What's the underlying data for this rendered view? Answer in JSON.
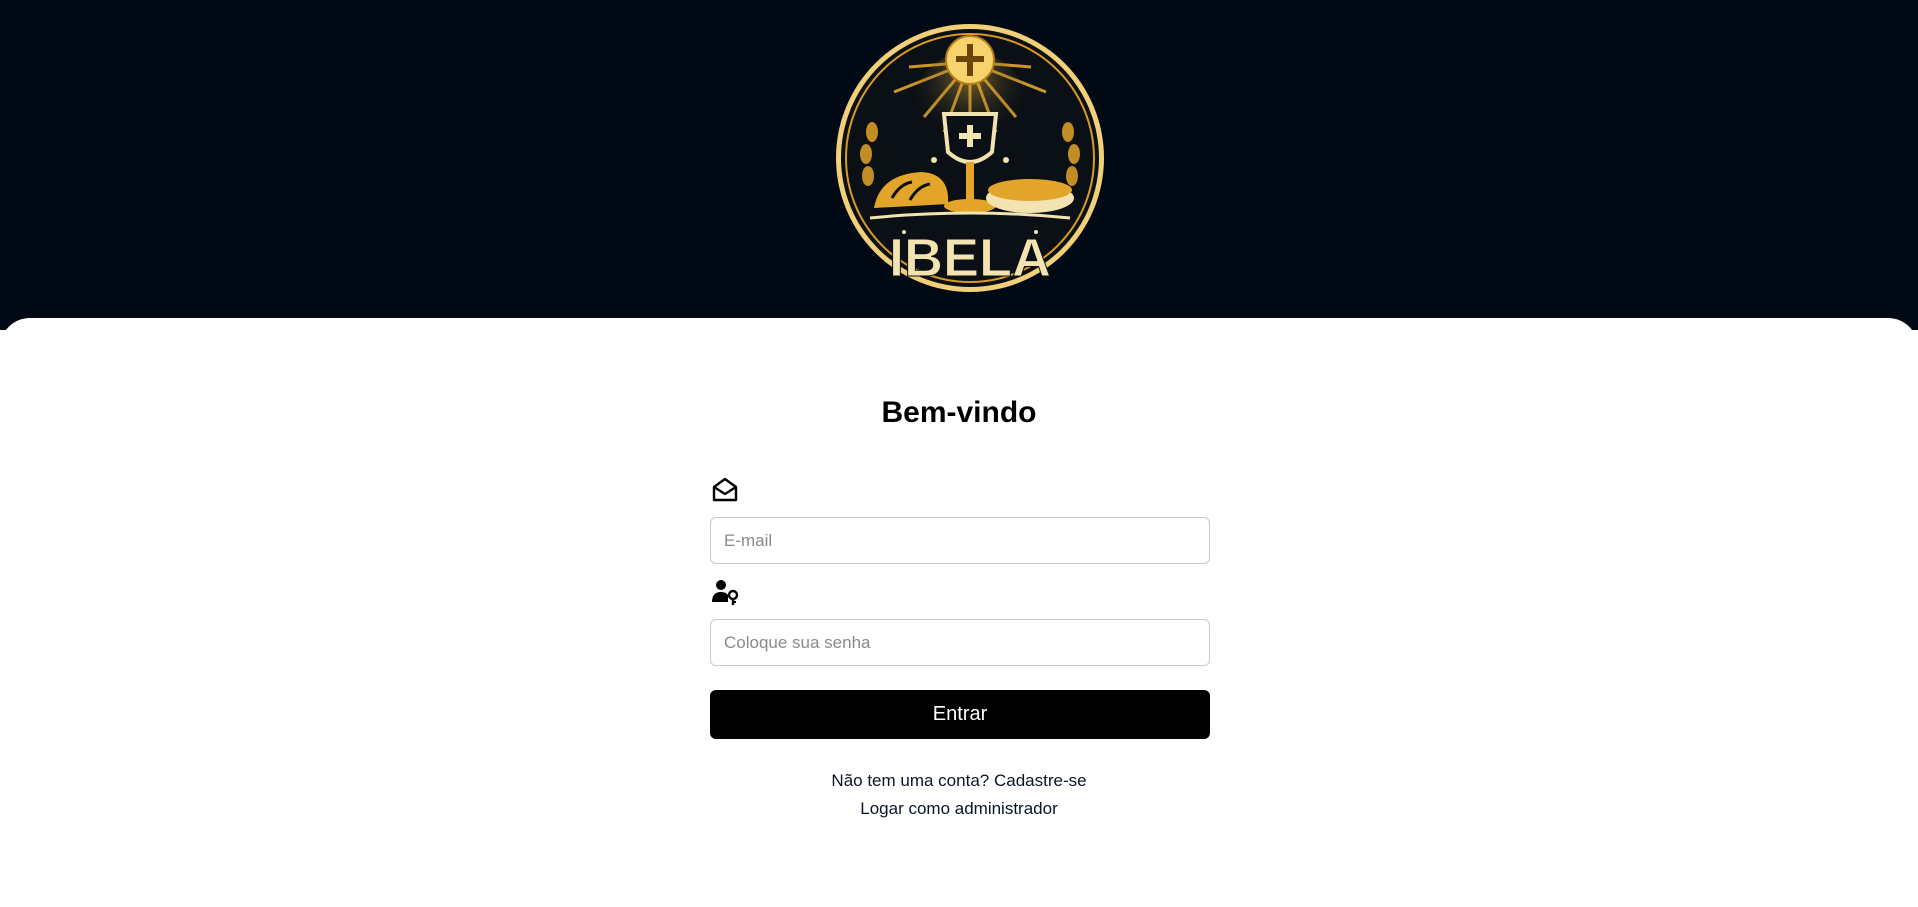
{
  "logo": {
    "text": "IBELA",
    "icon": "chalice-bread-logo",
    "colors": {
      "gold": "#e2a52a",
      "dark": "#0b1016",
      "cream": "#f3e3b0"
    }
  },
  "login": {
    "title": "Bem-vindo",
    "email": {
      "icon": "envelope-open-icon",
      "placeholder": "E-mail",
      "value": ""
    },
    "password": {
      "icon": "user-lock-icon",
      "placeholder": "Coloque sua senha",
      "value": ""
    },
    "submit_label": "Entrar",
    "signup_prompt": "Não tem uma conta?",
    "signup_link": "Cadastre-se",
    "admin_link": "Logar como administrador"
  },
  "colors": {
    "header_bg": "#010a14",
    "card_bg": "#ffffff",
    "button_bg": "#000000",
    "button_text": "#ffffff",
    "input_border": "#c8c8c8",
    "link_text": "#0a1628"
  }
}
